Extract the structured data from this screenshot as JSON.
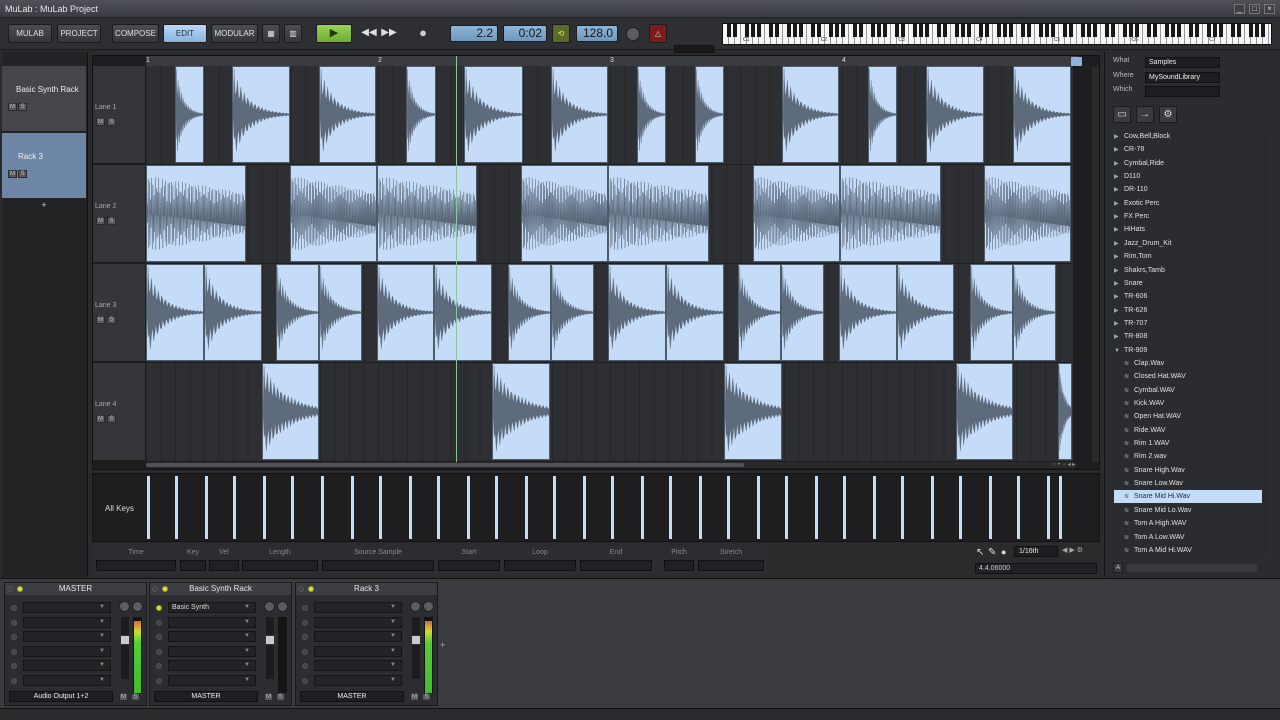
{
  "window": {
    "title": "MuLab : MuLab Project"
  },
  "toolbar": {
    "mulab": "MULAB",
    "project": "PROJECT",
    "compose": "COMPOSE",
    "edit": "EDIT",
    "modular": "MODULAR",
    "position": "2.2",
    "time": "0:02",
    "tempo": "128.0"
  },
  "keyboard": {
    "octave_labels": [
      "C1",
      "C2",
      "C3",
      "C4",
      "C5",
      "C6",
      "C7"
    ]
  },
  "tracks": [
    {
      "name": "Basic Synth Rack",
      "m": "M",
      "s": "S"
    },
    {
      "name": "Rack 3",
      "m": "M",
      "s": "S"
    }
  ],
  "add_track": "+",
  "ruler": {
    "marks": [
      "1",
      "2",
      "3",
      "4"
    ]
  },
  "lanes": [
    {
      "name": "Lane 1",
      "m": "M",
      "s": "S"
    },
    {
      "name": "Lane 2",
      "m": "M",
      "s": "S"
    },
    {
      "name": "Lane 3",
      "m": "M",
      "s": "S"
    },
    {
      "name": "Lane 4",
      "m": "M",
      "s": "S"
    }
  ],
  "keys_label": "All Keys",
  "props": [
    "Time",
    "Key",
    "Vel",
    "Length",
    "Source Sample",
    "Start",
    "Loop",
    "End",
    "Pitch",
    "Stretch"
  ],
  "snap": {
    "value": "1/16th",
    "position": "4.4.06000"
  },
  "browser": {
    "what_label": "What",
    "what_value": "Samples",
    "where_label": "Where",
    "where_value": "MySoundLibrary",
    "which_label": "Which",
    "which_value": "",
    "folders": [
      "Cow,Bell,Block",
      "CR-78",
      "Cymbal,Ride",
      "D110",
      "DR-110",
      "Exotic Perc",
      "FX Perc",
      "HiHats",
      "Jazz_Drum_Kit",
      "Rim,Tom",
      "Shakrs,Tamb",
      "Snare",
      "TR-606",
      "TR-626",
      "TR-707",
      "TR-808",
      "TR-909"
    ],
    "files": [
      "Clap.Wav",
      "Closed Hat.WAV",
      "Cymbal.WAV",
      "Kick.WAV",
      "Open Hat.WAV",
      "Ride.WAV",
      "Rim 1.WAV",
      "Rim 2.wav",
      "Snare High.Wav",
      "Snare Low.Wav",
      "Snare Mid Hi.Wav",
      "Snare Mid Lo.Wav",
      "Tom A High.WAV",
      "Tom A Low.WAV",
      "Tom A Mid Hi.WAV"
    ],
    "selected": "Snare Mid Hi.Wav",
    "footer_button": "A"
  },
  "mixer": [
    {
      "name": "MASTER",
      "insert": "",
      "output": "Audio Output 1+2",
      "m": "M",
      "s": "S",
      "level": 0.95
    },
    {
      "name": "Basic Synth Rack",
      "insert": "Basic Synth",
      "output": "MASTER",
      "m": "M",
      "s": "S",
      "level": 0
    },
    {
      "name": "Rack 3",
      "insert": "",
      "output": "MASTER",
      "m": "M",
      "s": "S",
      "level": 0.95
    }
  ],
  "colors": {
    "clip": "#c4dcf8",
    "accent": "#8ab4de",
    "playhead": "#8ec49a"
  }
}
